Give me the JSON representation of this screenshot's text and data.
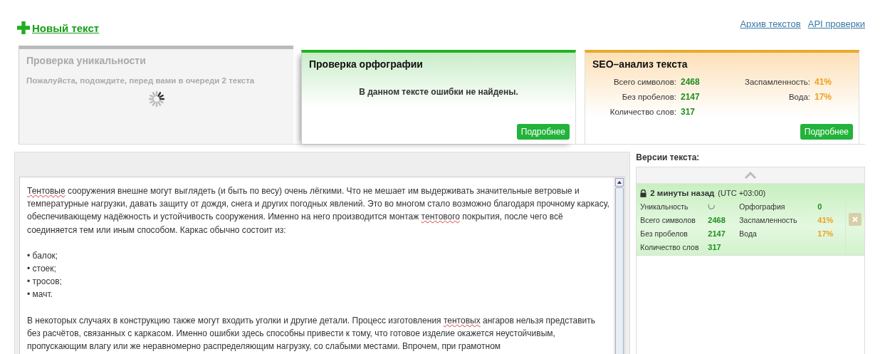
{
  "header": {
    "new_text": "Новый текст",
    "links": [
      "Архив текстов",
      "API проверки"
    ]
  },
  "cards": [
    {
      "kind": "pending",
      "title": "Проверка уникальности",
      "message": "Пожалуйста, подождите, перед вами в очереди 2 текста"
    },
    {
      "kind": "spelling",
      "title": "Проверка орфографии",
      "message": "В данном тексте ошибки не найдены.",
      "button": "Подробнее"
    },
    {
      "kind": "seo",
      "title": "SEO–анализ текста",
      "left": [
        {
          "label": "Всего символов:",
          "value": "2468"
        },
        {
          "label": "Без пробелов:",
          "value": "2147"
        },
        {
          "label": "Количество слов:",
          "value": "317"
        }
      ],
      "right": [
        {
          "label": "Заспамленность:",
          "value": "41%"
        },
        {
          "label": "Вода:",
          "value": "17%"
        }
      ],
      "button": "Подробнее"
    }
  ],
  "editor": {
    "paragraphs": [
      [
        {
          "text": "Тентовые",
          "error": true
        },
        {
          "text": " сооружения внешне могут выглядеть (и быть по весу) очень лёгкими. Что не мешает им выдерживать значительные ветровые и температурные нагрузки, давать защиту от дождя, снега и других погодных явлений. Это во многом стало возможно благодаря прочному каркасу, обеспечивающему надёжность и устойчивость сооружения. Именно на него производится монтаж ",
          "error": false
        },
        {
          "text": "тентового",
          "error": true
        },
        {
          "text": " покрытия, после чего всё соединяется тем или иным способом. Каркас обычно состоит из:",
          "error": false
        }
      ],
      [
        {
          "text": "• балок;",
          "error": false
        }
      ],
      [
        {
          "text": "• стоек;",
          "error": false
        }
      ],
      [
        {
          "text": "• тросов;",
          "error": false
        }
      ],
      [
        {
          "text": "• мачт.",
          "error": false
        }
      ],
      [
        {
          "text": "В некоторых случаях в конструкцию также могут входить уголки и другие детали. Процесс изготовления ",
          "error": false
        },
        {
          "text": "тентовых",
          "error": true
        },
        {
          "text": " ангаров нельзя представить без расчётов, связанных с каркасом. Именно ошибки здесь способны привести к тому, что готовое изделие окажется неустойчивым, пропускающим влагу или же неравномерно распределяющим нагрузку, со слабыми местами. Впрочем, при грамотном",
          "error": false
        }
      ]
    ]
  },
  "versions": {
    "title": "Версии текста:",
    "items": [
      {
        "selected": true,
        "locked": true,
        "time": "2 минуты назад",
        "zone": "(UTC +03:00)",
        "rows": [
          {
            "label": "Уникальность",
            "value": "",
            "pending": true,
            "label2": "Орфография",
            "value2": "0",
            "color": "#1f8f1f"
          },
          {
            "label": "Всего символов",
            "value": "2468",
            "pending": false,
            "label2": "Заспамленность",
            "value2": "41%",
            "color": "#f0a020"
          },
          {
            "label": "Без пробелов",
            "value": "2147",
            "pending": false,
            "label2": "Вода",
            "value2": "17%",
            "color": "#f0a020"
          },
          {
            "label": "Количество слов",
            "value": "317",
            "pending": false
          }
        ]
      }
    ]
  }
}
